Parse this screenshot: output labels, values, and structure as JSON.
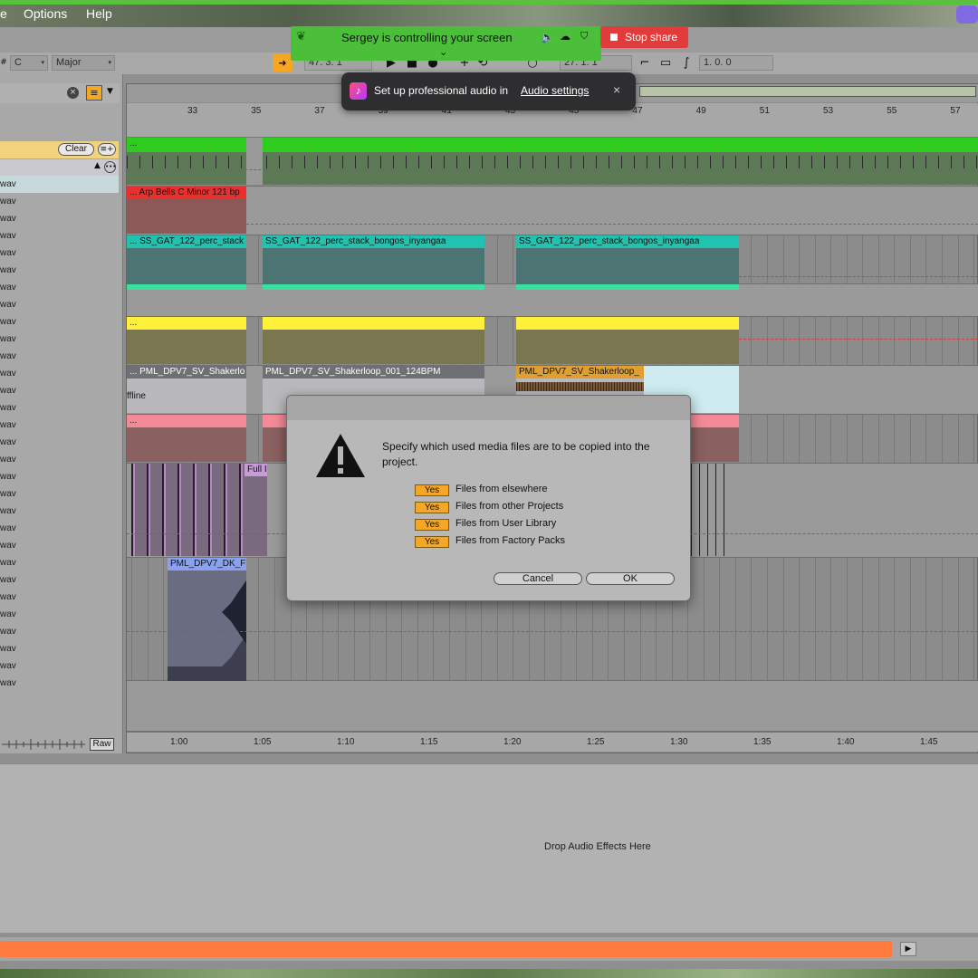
{
  "menubar": {
    "items": [
      "e",
      "Options",
      "Help"
    ]
  },
  "share": {
    "status_text": "Sergey is controlling your screen",
    "stop_label": "Stop share"
  },
  "notification": {
    "text": "Set up professional audio in",
    "link": "Audio settings",
    "close": "×"
  },
  "controlbar": {
    "key": "C",
    "scale": "Major",
    "position": "47.  3.  1",
    "loop_start": "27.  1.  1",
    "loop_length": "1.  0.  0"
  },
  "browser": {
    "clear_label": "Clear",
    "files": [
      "wav",
      "wav",
      "wav",
      "wav",
      "wav",
      "wav",
      "wav",
      "wav",
      "wav",
      "wav",
      "wav",
      "wav",
      "wav",
      "wav",
      "wav",
      "wav",
      "wav",
      "wav",
      "wav",
      "wav",
      "wav",
      "wav",
      "wav",
      "wav",
      "wav",
      "wav",
      "wav",
      "wav",
      "wav",
      "wav"
    ],
    "raw_label": "Raw"
  },
  "ruler": {
    "bars": [
      "33",
      "35",
      "37",
      "39",
      "41",
      "43",
      "45",
      "47",
      "49",
      "51",
      "53",
      "55",
      "57"
    ],
    "times": [
      "1:00",
      "1:05",
      "1:10",
      "1:15",
      "1:20",
      "1:25",
      "1:30",
      "1:35",
      "1:40",
      "1:45"
    ]
  },
  "clips": {
    "green": "...",
    "arp": "... Arp Bells C Minor 121 bp",
    "perc_a": "... SS_GAT_122_perc_stack",
    "perc_b": "SS_GAT_122_perc_stack_bongos_inyangaa",
    "perc_c": "SS_GAT_122_perc_stack_bongos_inyangaa",
    "yellow": "...",
    "shaker_a": "... PML_DPV7_SV_Shakerlo",
    "shaker_b": "PML_DPV7_SV_Shakerloop_001_124BPM",
    "shaker_c": "PML_DPV7_SV_Shakerloop_",
    "offline": "ffline",
    "pink": "...",
    "full": "Full I",
    "dk": "PML_DPV7_DK_F"
  },
  "dialog": {
    "message": "Specify which used media files are to be copied into the project.",
    "options": [
      {
        "toggle": "Yes",
        "label": "Files from elsewhere"
      },
      {
        "toggle": "Yes",
        "label": "Files from other Projects"
      },
      {
        "toggle": "Yes",
        "label": "Files from User Library"
      },
      {
        "toggle": "Yes",
        "label": "Files from Factory Packs"
      }
    ],
    "cancel_label": "Cancel",
    "ok_label": "OK"
  },
  "device": {
    "drop_hint": "Drop Audio Effects Here"
  },
  "colors": {
    "share_green": "#4bbf3a",
    "stop_red": "#e23b3b",
    "yes_orange": "#f5a623",
    "clip_green": "#2ecc1f",
    "clip_teal": "#22c2b0",
    "clip_yellow": "#fff13a",
    "clip_pink": "#f48a98",
    "clip_red": "#e8312e",
    "status_orange": "#ff7a3d"
  }
}
